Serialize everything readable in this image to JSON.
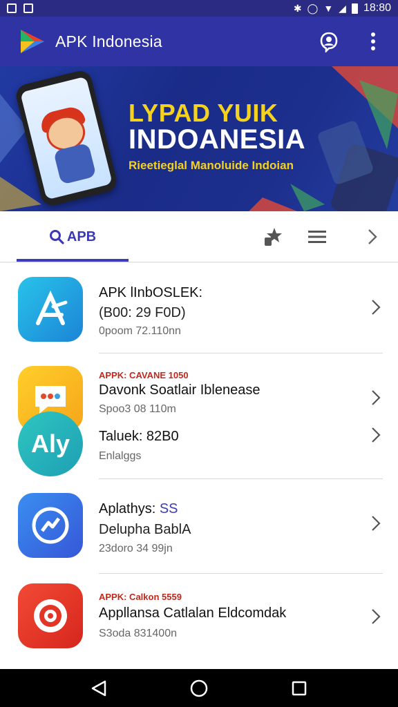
{
  "status_bar": {
    "time": "18:80"
  },
  "app_bar": {
    "title": "APK Indonesia",
    "accent_color": "#2f33a3"
  },
  "banner": {
    "title_line1": "LYPAD YUIK",
    "title_line2": "INDOANESIA",
    "subtitle": "Rieetieglal Manoluide Indoian"
  },
  "tabs": {
    "active_label": "APB"
  },
  "list": {
    "items": [
      {
        "title": "APK lInbOSLEK:",
        "subtitle": "(B00: 29 F0D)",
        "meta": "0poom 72.110nn",
        "icon": "app-store-icon"
      },
      {
        "tag": "APPK: CAVANE 1050",
        "title": "Davonk Soatlair Iblenease",
        "meta": "Spoo3 08 110m",
        "icon": "chat-bubble-icon"
      },
      {
        "title": "Taluek: 82B0",
        "meta": "Enlalggs",
        "icon": "aly-logo-icon"
      },
      {
        "title_prefix": "Aplathys: ",
        "title_accent": "SS",
        "subtitle": "Delupha BablA",
        "meta": "23doro 34 99jn",
        "icon": "messenger-icon"
      },
      {
        "tag": "APPK: Calkon 5559",
        "title": "Appllansa Catlalan Eldcomdak",
        "meta": "S3oda 831400n",
        "icon": "target-icon"
      }
    ]
  }
}
